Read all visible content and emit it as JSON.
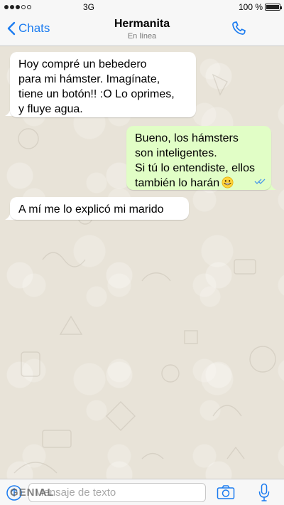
{
  "status_bar": {
    "carrier": "3G",
    "battery": "100 %"
  },
  "header": {
    "back_label": "Chats",
    "contact_name": "Hermanita",
    "contact_status": "En línea"
  },
  "messages": [
    {
      "direction": "incoming",
      "lines": [
        "Hoy compré un bebedero",
        "para mi hámster. Imagínate,",
        "tiene un botón!! :O Lo oprimes,",
        "y fluye agua."
      ]
    },
    {
      "direction": "outgoing",
      "lines": [
        "Bueno, los hámsters",
        "son inteligentes.",
        "Si tú lo entendiste, ellos",
        "también lo harán"
      ],
      "emoji": "grinning-face-icon",
      "status": "read"
    },
    {
      "direction": "incoming",
      "lines": [
        "A mí me lo explicó mi marido"
      ]
    }
  ],
  "input_bar": {
    "placeholder": "Mensaje de texto",
    "watermark": "GENIAL"
  },
  "colors": {
    "accent": "#1a7bf0",
    "outgoing_bubble": "#e1fec6",
    "incoming_bubble": "#ffffff",
    "wallpaper": "#e8e3d8"
  }
}
